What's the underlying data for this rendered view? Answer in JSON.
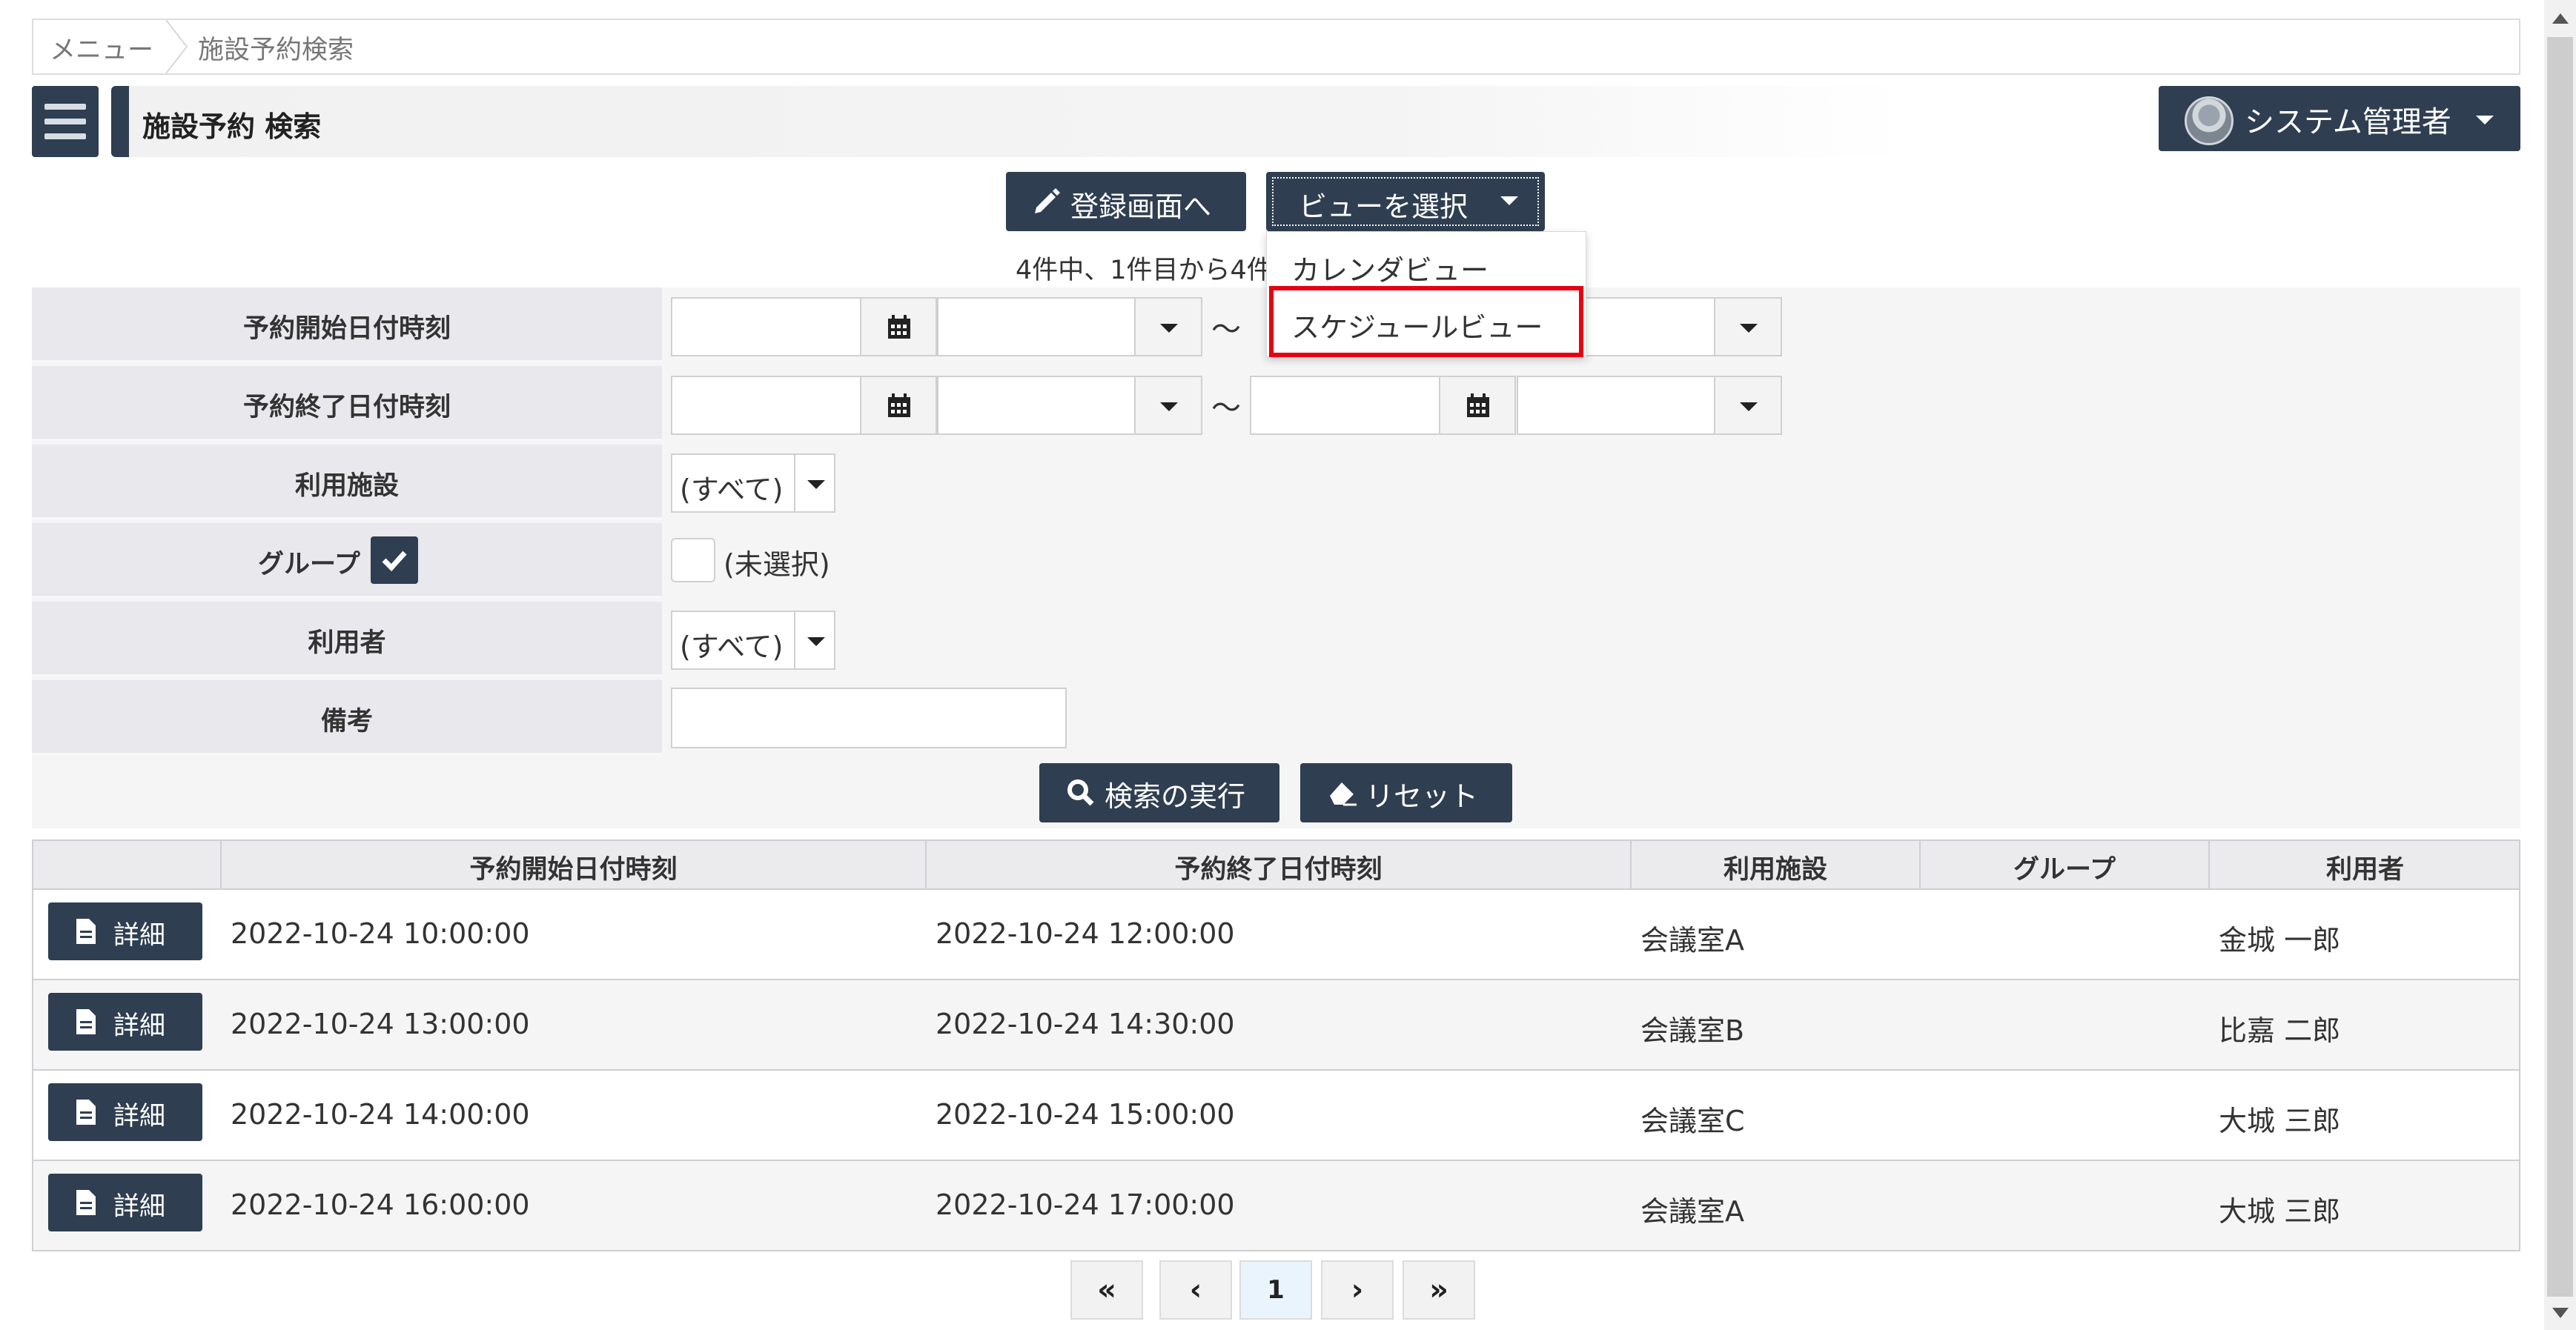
{
  "breadcrumb": {
    "menu": "メニュー",
    "current": "施設予約検索"
  },
  "header": {
    "title": "施設予約 検索",
    "user": "システム管理者"
  },
  "toolbar": {
    "register": "登録画面へ",
    "view_select": "ビューを選択"
  },
  "dropdown": {
    "items": [
      "カレンダビュー",
      "スケジュールビュー"
    ],
    "highlighted": "スケジュールビュー"
  },
  "result_count": "4件中、1件目から4件",
  "search": {
    "start_label": "予約開始日付時刻",
    "end_label": "予約終了日付時刻",
    "facility_label": "利用施設",
    "facility_value": "(すべて)",
    "group_label": "グループ",
    "group_value": "(未選択)",
    "user_label": "利用者",
    "user_value": "(すべて)",
    "note_label": "備考",
    "tilde": "～",
    "search_button": "検索の実行",
    "reset_button": "リセット"
  },
  "table": {
    "headers": [
      "",
      "予約開始日付時刻",
      "予約終了日付時刻",
      "利用施設",
      "グループ",
      "利用者"
    ],
    "detail_label": "詳細",
    "rows": [
      {
        "start": "2022-10-24 10:00:00",
        "end": "2022-10-24 12:00:00",
        "facility": "会議室A",
        "group": "",
        "user": "金城 一郎"
      },
      {
        "start": "2022-10-24 13:00:00",
        "end": "2022-10-24 14:30:00",
        "facility": "会議室B",
        "group": "",
        "user": "比嘉 二郎"
      },
      {
        "start": "2022-10-24 14:00:00",
        "end": "2022-10-24 15:00:00",
        "facility": "会議室C",
        "group": "",
        "user": "大城 三郎"
      },
      {
        "start": "2022-10-24 16:00:00",
        "end": "2022-10-24 17:00:00",
        "facility": "会議室A",
        "group": "",
        "user": "大城 三郎"
      }
    ]
  },
  "pagination": {
    "first": "«",
    "prev": "‹",
    "current": "1",
    "next": "›",
    "last": "»"
  },
  "colors": {
    "primary": "#2f3e51",
    "highlight": "#e60012",
    "label_bg": "#e8e8ed"
  }
}
